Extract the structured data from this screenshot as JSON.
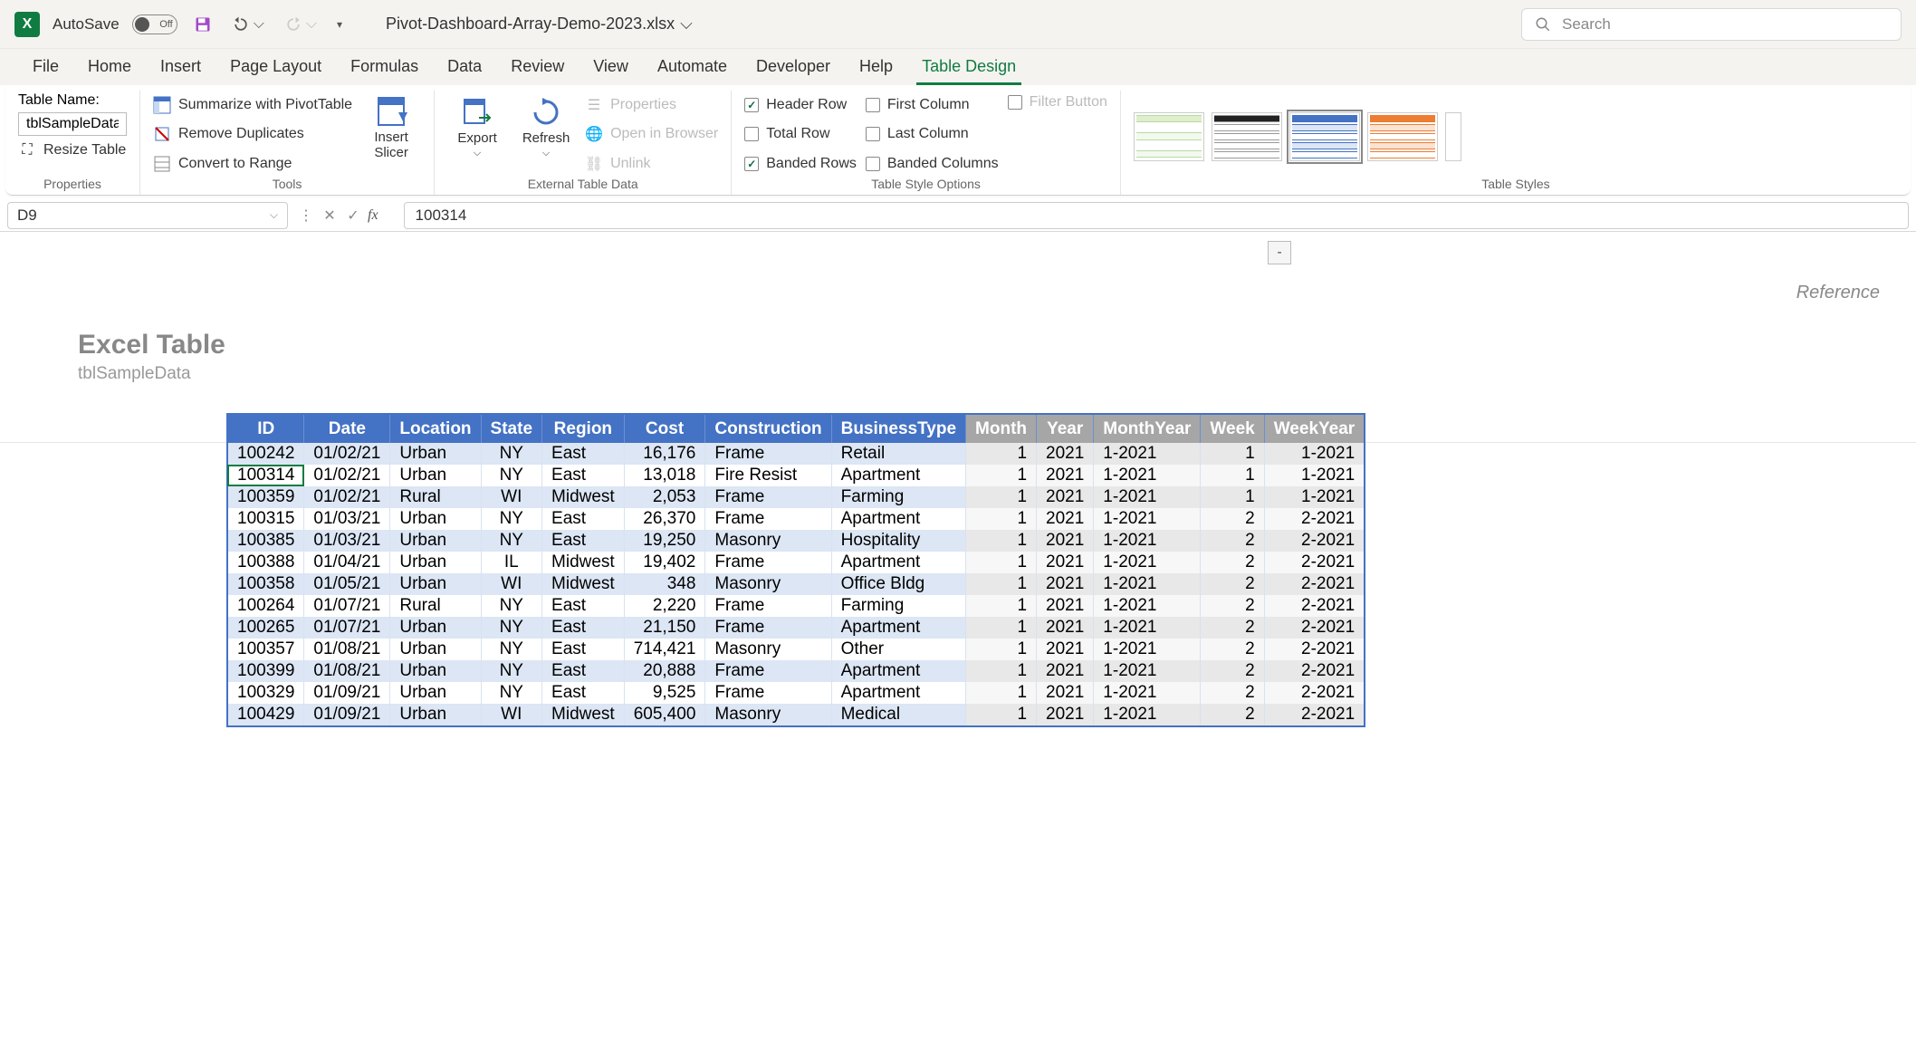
{
  "titlebar": {
    "autosave_label": "AutoSave",
    "autosave_state": "Off",
    "filename": "Pivot-Dashboard-Array-Demo-2023.xlsx",
    "search_placeholder": "Search"
  },
  "tabs": {
    "file": "File",
    "home": "Home",
    "insert": "Insert",
    "page_layout": "Page Layout",
    "formulas": "Formulas",
    "data": "Data",
    "review": "Review",
    "view": "View",
    "automate": "Automate",
    "developer": "Developer",
    "help": "Help",
    "table_design": "Table Design"
  },
  "ribbon": {
    "properties": {
      "table_name_label": "Table Name:",
      "table_name_value": "tblSampleData",
      "resize_table": "Resize Table",
      "group_label": "Properties"
    },
    "tools": {
      "summarize": "Summarize with PivotTable",
      "remove_dupes": "Remove Duplicates",
      "convert_range": "Convert to Range",
      "insert_slicer": "Insert Slicer",
      "group_label": "Tools"
    },
    "external": {
      "export": "Export",
      "refresh": "Refresh",
      "properties": "Properties",
      "open_browser": "Open in Browser",
      "unlink": "Unlink",
      "group_label": "External Table Data"
    },
    "style_options": {
      "header_row": "Header Row",
      "total_row": "Total Row",
      "banded_rows": "Banded Rows",
      "first_column": "First Column",
      "last_column": "Last Column",
      "banded_columns": "Banded Columns",
      "filter_button": "Filter Button",
      "group_label": "Table Style Options"
    },
    "styles": {
      "group_label": "Table Styles"
    }
  },
  "formula_bar": {
    "name_box": "D9",
    "value": "100314"
  },
  "canvas": {
    "float_btn": "-",
    "reference": "Reference",
    "title": "Excel Table",
    "subtitle": "tblSampleData"
  },
  "table": {
    "headers": [
      "ID",
      "Date",
      "Location",
      "State",
      "Region",
      "Cost",
      "Construction",
      "BusinessType"
    ],
    "ext_headers": [
      "Month",
      "Year",
      "MonthYear",
      "Week",
      "WeekYear"
    ],
    "rows": [
      {
        "id": "100242",
        "date": "01/02/21",
        "loc": "Urban",
        "state": "NY",
        "region": "East",
        "cost": "16,176",
        "constr": "Frame",
        "biz": "Retail",
        "month": "1",
        "year": "2021",
        "my": "1-2021",
        "week": "1",
        "wy": "1-2021"
      },
      {
        "id": "100314",
        "date": "01/02/21",
        "loc": "Urban",
        "state": "NY",
        "region": "East",
        "cost": "13,018",
        "constr": "Fire Resist",
        "biz": "Apartment",
        "month": "1",
        "year": "2021",
        "my": "1-2021",
        "week": "1",
        "wy": "1-2021",
        "selected": true
      },
      {
        "id": "100359",
        "date": "01/02/21",
        "loc": "Rural",
        "state": "WI",
        "region": "Midwest",
        "cost": "2,053",
        "constr": "Frame",
        "biz": "Farming",
        "month": "1",
        "year": "2021",
        "my": "1-2021",
        "week": "1",
        "wy": "1-2021"
      },
      {
        "id": "100315",
        "date": "01/03/21",
        "loc": "Urban",
        "state": "NY",
        "region": "East",
        "cost": "26,370",
        "constr": "Frame",
        "biz": "Apartment",
        "month": "1",
        "year": "2021",
        "my": "1-2021",
        "week": "2",
        "wy": "2-2021"
      },
      {
        "id": "100385",
        "date": "01/03/21",
        "loc": "Urban",
        "state": "NY",
        "region": "East",
        "cost": "19,250",
        "constr": "Masonry",
        "biz": "Hospitality",
        "month": "1",
        "year": "2021",
        "my": "1-2021",
        "week": "2",
        "wy": "2-2021"
      },
      {
        "id": "100388",
        "date": "01/04/21",
        "loc": "Urban",
        "state": "IL",
        "region": "Midwest",
        "cost": "19,402",
        "constr": "Frame",
        "biz": "Apartment",
        "month": "1",
        "year": "2021",
        "my": "1-2021",
        "week": "2",
        "wy": "2-2021"
      },
      {
        "id": "100358",
        "date": "01/05/21",
        "loc": "Urban",
        "state": "WI",
        "region": "Midwest",
        "cost": "348",
        "constr": "Masonry",
        "biz": "Office Bldg",
        "month": "1",
        "year": "2021",
        "my": "1-2021",
        "week": "2",
        "wy": "2-2021"
      },
      {
        "id": "100264",
        "date": "01/07/21",
        "loc": "Rural",
        "state": "NY",
        "region": "East",
        "cost": "2,220",
        "constr": "Frame",
        "biz": "Farming",
        "month": "1",
        "year": "2021",
        "my": "1-2021",
        "week": "2",
        "wy": "2-2021"
      },
      {
        "id": "100265",
        "date": "01/07/21",
        "loc": "Urban",
        "state": "NY",
        "region": "East",
        "cost": "21,150",
        "constr": "Frame",
        "biz": "Apartment",
        "month": "1",
        "year": "2021",
        "my": "1-2021",
        "week": "2",
        "wy": "2-2021"
      },
      {
        "id": "100357",
        "date": "01/08/21",
        "loc": "Urban",
        "state": "NY",
        "region": "East",
        "cost": "714,421",
        "constr": "Masonry",
        "biz": "Other",
        "month": "1",
        "year": "2021",
        "my": "1-2021",
        "week": "2",
        "wy": "2-2021"
      },
      {
        "id": "100399",
        "date": "01/08/21",
        "loc": "Urban",
        "state": "NY",
        "region": "East",
        "cost": "20,888",
        "constr": "Frame",
        "biz": "Apartment",
        "month": "1",
        "year": "2021",
        "my": "1-2021",
        "week": "2",
        "wy": "2-2021"
      },
      {
        "id": "100329",
        "date": "01/09/21",
        "loc": "Urban",
        "state": "NY",
        "region": "East",
        "cost": "9,525",
        "constr": "Frame",
        "biz": "Apartment",
        "month": "1",
        "year": "2021",
        "my": "1-2021",
        "week": "2",
        "wy": "2-2021"
      },
      {
        "id": "100429",
        "date": "01/09/21",
        "loc": "Urban",
        "state": "WI",
        "region": "Midwest",
        "cost": "605,400",
        "constr": "Masonry",
        "biz": "Medical",
        "month": "1",
        "year": "2021",
        "my": "1-2021",
        "week": "2",
        "wy": "2-2021"
      }
    ]
  }
}
